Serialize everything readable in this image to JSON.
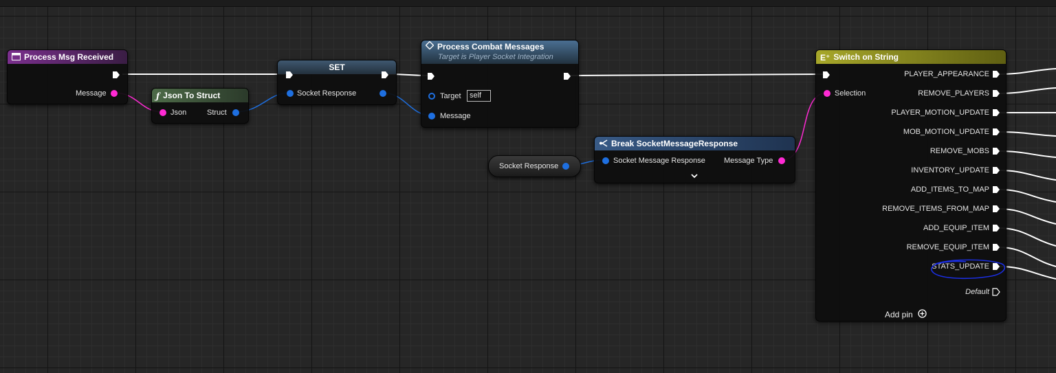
{
  "nodes": {
    "process_msg_received": {
      "title": "Process Msg Received",
      "output_pin": "Message"
    },
    "json_to_struct": {
      "title": "Json To Struct",
      "input_pin": "Json",
      "output_pin": "Struct"
    },
    "set": {
      "title": "SET",
      "input_pin": "Socket Response"
    },
    "process_combat": {
      "title": "Process Combat Messages",
      "subtitle": "Target is Player Socket Integration",
      "target_label": "Target",
      "target_value": "self",
      "message_label": "Message"
    },
    "socket_response_getter": {
      "label": "Socket Response"
    },
    "break_struct": {
      "title": "Break SocketMessageResponse",
      "input_pin": "Socket Message Response",
      "output_pin": "Message Type"
    },
    "switch_on_string": {
      "title": "Switch on String",
      "selection_label": "Selection",
      "cases": [
        "PLAYER_APPEARANCE",
        "REMOVE_PLAYERS",
        "PLAYER_MOTION_UPDATE",
        "MOB_MOTION_UPDATE",
        "REMOVE_MOBS",
        "INVENTORY_UPDATE",
        "ADD_ITEMS_TO_MAP",
        "REMOVE_ITEMS_FROM_MAP",
        "ADD_EQUIP_ITEM",
        "REMOVE_EQUIP_ITEM",
        "STATS_UPDATE"
      ],
      "default_label": "Default",
      "add_pin_label": "Add pin"
    }
  },
  "colors": {
    "exec_wire": "#ffffff",
    "string_wire": "#ff2ad4",
    "struct_wire": "#1e6fe0",
    "event_header": "#6b2a7c",
    "function_header": "#3d5a3b",
    "call_header": "#3e5f7c",
    "switch_header": "#8a8a1a",
    "break_header": "#2f4c72",
    "annotation": "#1b2ee0"
  },
  "icons": {
    "event": "event-node-icon",
    "function": "function-icon",
    "call": "function-call-icon",
    "break": "break-struct-icon",
    "switch": "switch-icon",
    "add": "add-pin-icon",
    "expand": "chevron-down-icon"
  }
}
